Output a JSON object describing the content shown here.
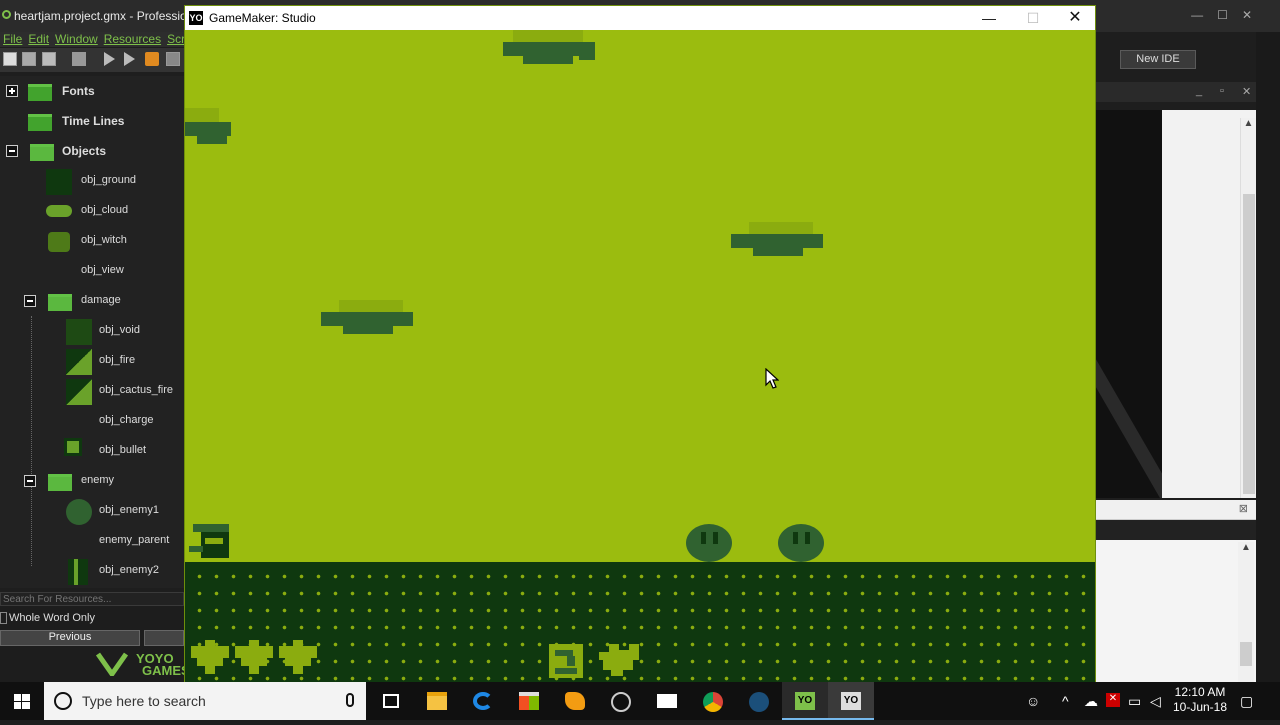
{
  "ide": {
    "title": "heartjam.project.gmx - Professional Edition",
    "menu": [
      "File",
      "Edit",
      "Window",
      "Resources",
      "Scripts"
    ],
    "tree": {
      "fonts": "Fonts",
      "timelines": "Time Lines",
      "objects": "Objects",
      "obj_ground": "obj_ground",
      "obj_cloud": "obj_cloud",
      "obj_witch": "obj_witch",
      "obj_view": "obj_view",
      "damage": "damage",
      "obj_void": "obj_void",
      "obj_fire": "obj_fire",
      "obj_cactus_fire": "obj_cactus_fire",
      "obj_charge": "obj_charge",
      "obj_bullet": "obj_bullet",
      "enemy": "enemy",
      "obj_enemy1": "obj_enemy1",
      "enemy_parent": "enemy_parent",
      "obj_enemy2": "obj_enemy2"
    },
    "search_placeholder": "Search For Resources...",
    "whole_word": "Whole Word Only",
    "previous": "Previous",
    "yoyo_line1": "YOYO",
    "yoyo_line2": "GAMES",
    "new_ide": "New IDE"
  },
  "game": {
    "window_title": "GameMaker: Studio",
    "icon_text": "YO",
    "colors": {
      "light": "#9bbc0f",
      "mid": "#8bac0f",
      "dark": "#306230",
      "darkest": "#0f380f"
    }
  },
  "taskbar": {
    "search_placeholder": "Type here to search",
    "time": "12:10 AM",
    "date": "10-Jun-18"
  }
}
